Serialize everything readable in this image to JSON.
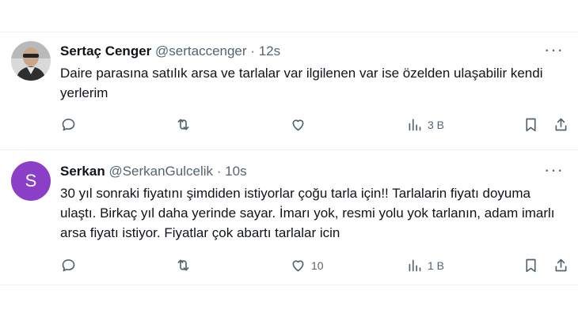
{
  "tweets": [
    {
      "name": "Sertaç Cenger",
      "handle": "@sertaccenger",
      "separator": "·",
      "time": "12s",
      "text": "Daire parasına satılık arsa ve tarlalar var ilgilenen var ise özelden ulaşabilir kendi yerlerim",
      "more": "···",
      "counts": {
        "reply": "",
        "retweet": "",
        "like": "",
        "views": "3 B"
      }
    },
    {
      "name": "Serkan",
      "handle": "@SerkanGulcelik",
      "separator": "·",
      "time": "10s",
      "avatar_letter": "S",
      "text": "30 yıl sonraki fiyatını şimdiden istiyorlar çoğu tarla için!! Tarlalarin fiyatı doyuma ulaştı. Birkaç yıl daha yerinde sayar. İmarı yok, resmi yolu yok tarlanın, adam imarlı arsa fiyatı istiyor. Fiyatlar çok abartı tarlalar icin",
      "more": "···",
      "counts": {
        "reply": "",
        "retweet": "",
        "like": "10",
        "views": "1 B"
      }
    }
  ],
  "colors": {
    "text": "#0f1419",
    "secondary": "#536471",
    "divider": "#eff3f4",
    "avatar_bg": "#8b3fc7"
  },
  "icons": [
    "reply-icon",
    "retweet-icon",
    "like-icon",
    "views-icon",
    "bookmark-icon",
    "share-icon",
    "more-icon"
  ]
}
